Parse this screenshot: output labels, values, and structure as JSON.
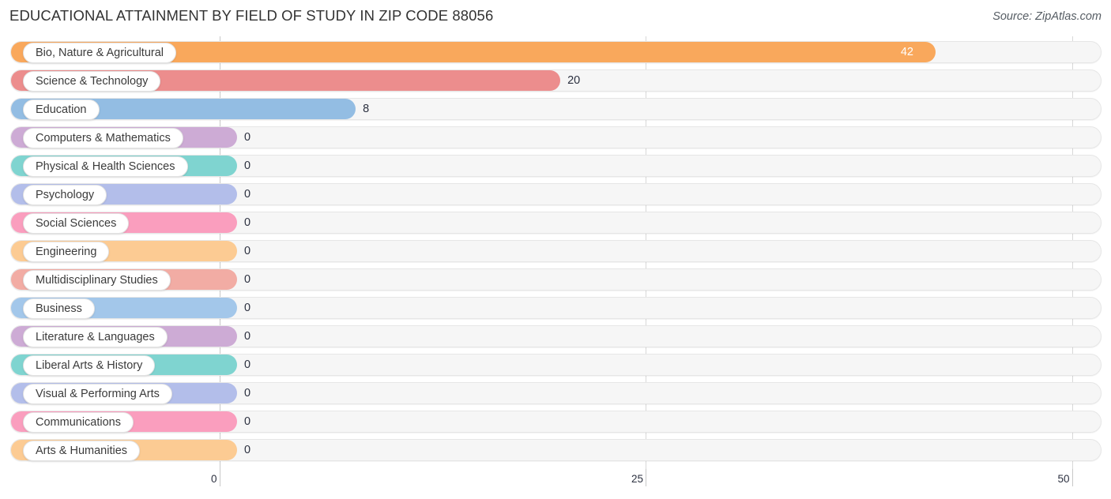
{
  "header": {
    "title": "EDUCATIONAL ATTAINMENT BY FIELD OF STUDY IN ZIP CODE 88056",
    "source": "Source: ZipAtlas.com"
  },
  "chart_data": {
    "type": "bar",
    "orientation": "horizontal",
    "title": "EDUCATIONAL ATTAINMENT BY FIELD OF STUDY IN ZIP CODE 88056",
    "xlabel": "",
    "ylabel": "",
    "xlim": [
      0,
      50
    ],
    "xticks": [
      0,
      25,
      50
    ],
    "xtick_labels": [
      "0",
      "25",
      "50"
    ],
    "grid": true,
    "legend": "none",
    "categories": [
      "Bio, Nature & Agricultural",
      "Science & Technology",
      "Education",
      "Computers & Mathematics",
      "Physical & Health Sciences",
      "Psychology",
      "Social Sciences",
      "Engineering",
      "Multidisciplinary Studies",
      "Business",
      "Literature & Languages",
      "Liberal Arts & History",
      "Visual & Performing Arts",
      "Communications",
      "Arts & Humanities"
    ],
    "values": [
      42,
      20,
      8,
      0,
      0,
      0,
      0,
      0,
      0,
      0,
      0,
      0,
      0,
      0,
      0
    ],
    "value_labels": [
      "42",
      "20",
      "8",
      "0",
      "0",
      "0",
      "0",
      "0",
      "0",
      "0",
      "0",
      "0",
      "0",
      "0",
      "0"
    ],
    "colors": [
      "#F9A85C",
      "#EC8D8D",
      "#93BDE3",
      "#CDABD5",
      "#7FD4D0",
      "#B3BEEA",
      "#FA9EBE",
      "#FCCB93",
      "#F2ACA4",
      "#A3C7EA",
      "#CDABD5",
      "#7FD4D0",
      "#B3BEEA",
      "#FA9EBE",
      "#FCCB93"
    ]
  }
}
